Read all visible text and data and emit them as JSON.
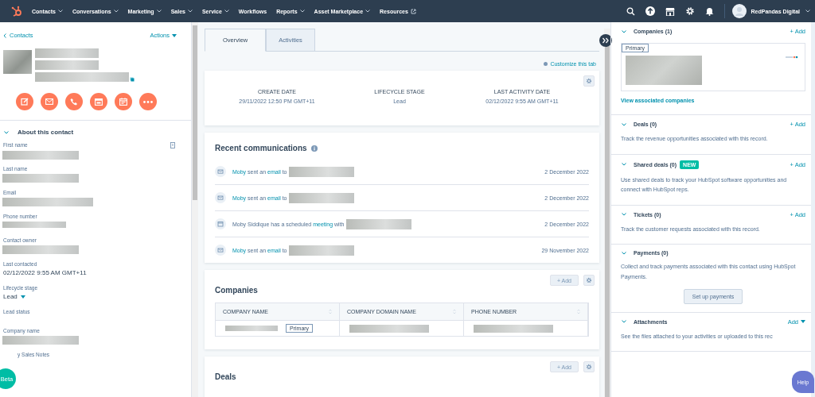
{
  "nav": {
    "items": [
      {
        "label": "Contacts",
        "kind": "menu"
      },
      {
        "label": "Conversations",
        "kind": "menu"
      },
      {
        "label": "Marketing",
        "kind": "menu"
      },
      {
        "label": "Sales",
        "kind": "menu"
      },
      {
        "label": "Service",
        "kind": "menu"
      },
      {
        "label": "Workflows",
        "kind": "link"
      },
      {
        "label": "Reports",
        "kind": "menu"
      },
      {
        "label": "Asset Marketplace",
        "kind": "menu"
      },
      {
        "label": "Resources",
        "kind": "external"
      }
    ],
    "account": {
      "name": "RedPandas Digital"
    }
  },
  "contact_panel": {
    "back_link": "Contacts",
    "actions": "Actions",
    "about": {
      "title": "About this contact",
      "expanded": true
    },
    "fields": [
      {
        "label": "First name",
        "kind": "redacted"
      },
      {
        "label": "Last name",
        "kind": "redacted"
      },
      {
        "label": "Email",
        "kind": "redacted"
      },
      {
        "label": "Phone number",
        "kind": "redacted"
      },
      {
        "label": "Contact owner",
        "kind": "redacted"
      },
      {
        "label": "Last contacted",
        "kind": "text",
        "value": "02/12/2022 9:55 AM GMT+11"
      },
      {
        "label": "Lifecycle stage",
        "kind": "dropdown",
        "value": "Lead"
      },
      {
        "label": "Lead status",
        "kind": "empty"
      },
      {
        "label": "Company name",
        "kind": "redacted"
      },
      {
        "label": "y Sales Notes",
        "kind": "empty"
      }
    ]
  },
  "beta": "Beta",
  "tabs": [
    {
      "label": "Overview",
      "selected": true
    },
    {
      "label": "Activities",
      "selected": false
    }
  ],
  "customize": "Customize this tab",
  "highlights": [
    {
      "label": "CREATE DATE",
      "value": "29/11/2022 12:50 PM GMT+11"
    },
    {
      "label": "LIFECYCLE STAGE",
      "value": "Lead"
    },
    {
      "label": "LAST ACTIVITY DATE",
      "value": "02/12/2022 9:55 AM GMT+11"
    }
  ],
  "recent": {
    "title": "Recent communications",
    "items": [
      {
        "kind": "email",
        "parts": [
          {
            "text": "Moby",
            "kind": "link"
          },
          {
            "text": " sent an ",
            "kind": "text"
          },
          {
            "text": "email",
            "kind": "link"
          },
          {
            "text": " to",
            "kind": "text"
          }
        ],
        "date": "2 December 2022"
      },
      {
        "kind": "email",
        "parts": [
          {
            "text": "Moby",
            "kind": "link"
          },
          {
            "text": " sent an ",
            "kind": "text"
          },
          {
            "text": "email",
            "kind": "link"
          },
          {
            "text": " to",
            "kind": "text"
          }
        ],
        "date": "2 December 2022"
      },
      {
        "kind": "meeting",
        "parts": [
          {
            "text": "Moby Siddique has a scheduled ",
            "kind": "text"
          },
          {
            "text": "meeting",
            "kind": "link"
          },
          {
            "text": " with",
            "kind": "text"
          }
        ],
        "date": "2 December 2022"
      },
      {
        "kind": "email",
        "parts": [
          {
            "text": "Moby",
            "kind": "link"
          },
          {
            "text": " sent an ",
            "kind": "text"
          },
          {
            "text": "email",
            "kind": "link"
          },
          {
            "text": " to",
            "kind": "text"
          }
        ],
        "date": "29 November 2022"
      }
    ]
  },
  "companies": {
    "title": "Companies",
    "add": "+ Add",
    "columns": [
      "COMPANY NAME",
      "COMPANY DOMAIN NAME",
      "PHONE NUMBER"
    ],
    "rows": [
      {
        "badge": "Primary"
      }
    ]
  },
  "deals": {
    "title": "Deals",
    "add": "+ Add"
  },
  "sidebar": {
    "sections": [
      {
        "kind": "companies",
        "title": "Companies (1)",
        "action": "+ Add",
        "badge": "Primary",
        "link": "View associated companies"
      },
      {
        "kind": "text",
        "title": "Deals (0)",
        "action": "+ Add",
        "description": "Track the revenue opportunities associated with this record."
      },
      {
        "kind": "text",
        "title": "Shared deals (0)",
        "tag": "NEW",
        "action": "+ Add",
        "description": "Use shared deals to track your HubSpot software opportunities and connect with HubSpot reps."
      },
      {
        "kind": "text",
        "title": "Tickets (0)",
        "action": "+ Add",
        "description": "Track the customer requests associated with this record."
      },
      {
        "kind": "button",
        "title": "Payments (0)",
        "description": "Collect and track payments associated with this contact using HubSpot Payments.",
        "button": "Set up payments"
      },
      {
        "kind": "dropdown",
        "title": "Attachments",
        "action": "Add",
        "description": "See the files attached to your activities or uploaded to this rec"
      }
    ]
  },
  "help": "Help"
}
